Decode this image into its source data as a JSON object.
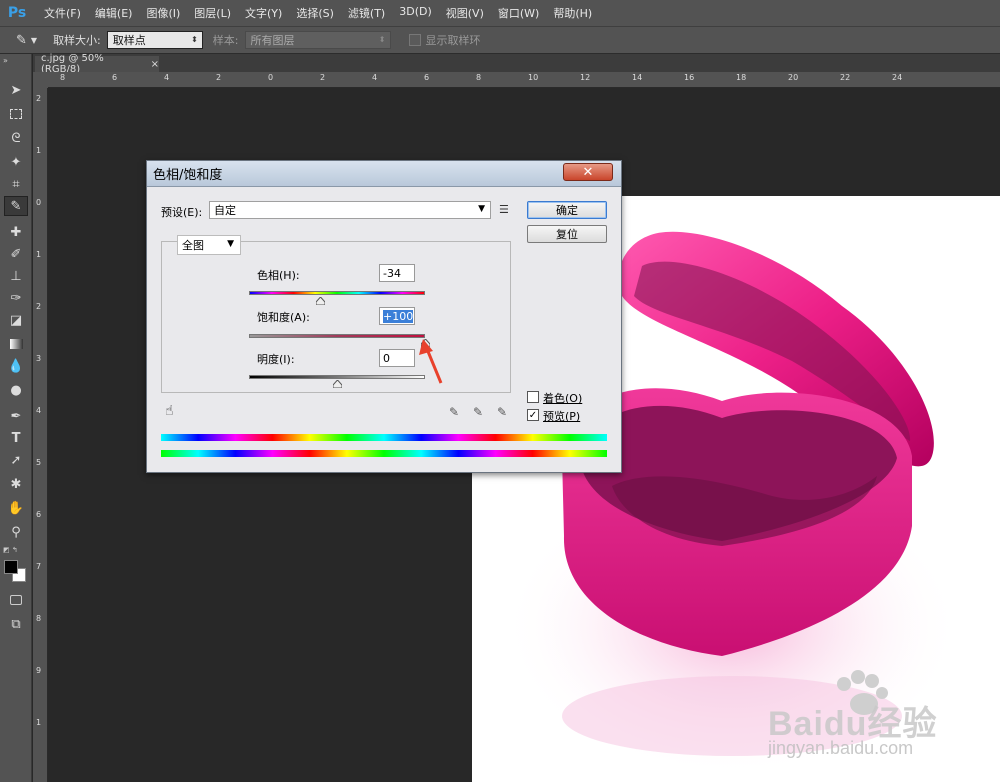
{
  "app": {
    "logo": "Ps"
  },
  "menu": [
    "文件(F)",
    "编辑(E)",
    "图像(I)",
    "图层(L)",
    "文字(Y)",
    "选择(S)",
    "滤镜(T)",
    "3D(D)",
    "视图(V)",
    "窗口(W)",
    "帮助(H)"
  ],
  "options": {
    "sample_size_label": "取样大小:",
    "sample_size_value": "取样点",
    "sample_label": "样本:",
    "sample_value": "所有图层",
    "show_ring_label": "显示取样环"
  },
  "document_tab": {
    "label": "c.jpg @ 50%(RGB/8)",
    "close": "×"
  },
  "ruler": {
    "h_ticks": [
      "8",
      "6",
      "4",
      "2",
      "0",
      "2",
      "4",
      "6",
      "8",
      "10",
      "12",
      "14",
      "16",
      "18",
      "20",
      "22",
      "24"
    ],
    "v_ticks": [
      "2",
      "1",
      "0",
      "1",
      "2",
      "3",
      "4",
      "5",
      "6",
      "7",
      "8",
      "9",
      "1"
    ]
  },
  "dialog": {
    "title": "色相/饱和度",
    "close": "✕",
    "preset_label": "预设(E):",
    "preset_value": "自定",
    "ok": "确定",
    "reset": "复位",
    "channel": "全图",
    "hue_label": "色相(H):",
    "hue_value": "-34",
    "hue_fraction": 0.405,
    "saturation_label": "饱和度(A):",
    "saturation_value": "+100",
    "saturation_fraction": 1.0,
    "lightness_label": "明度(I):",
    "lightness_value": "0",
    "lightness_fraction": 0.5,
    "colorize_label": "着色(O)",
    "colorize_checked": false,
    "preview_label": "预览(P)",
    "preview_checked": true
  },
  "watermark": {
    "brand": "Baidu经验",
    "url": "jingyan.baidu.com"
  },
  "colors": {
    "accent": "#3b7fd8",
    "arrow": "#e8412c",
    "box": "#ec1f87"
  }
}
